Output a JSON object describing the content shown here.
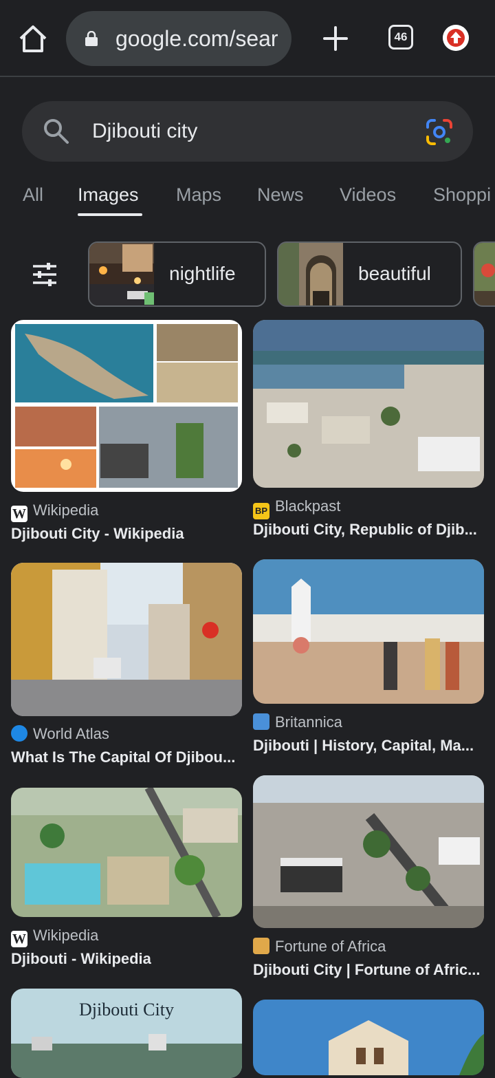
{
  "browser": {
    "url": "google.com/sear",
    "tab_count": "46"
  },
  "search": {
    "query": "Djibouti city"
  },
  "tabs": [
    {
      "label": "All"
    },
    {
      "label": "Images"
    },
    {
      "label": "Maps"
    },
    {
      "label": "News"
    },
    {
      "label": "Videos"
    },
    {
      "label": "Shoppi"
    }
  ],
  "chips": [
    {
      "label": "nightlife"
    },
    {
      "label": "beautiful"
    }
  ],
  "results": [
    {
      "source": "Wikipedia",
      "title": "Djibouti City - Wikipedia"
    },
    {
      "source": "Blackpast",
      "title": "Djibouti City, Republic of Djib..."
    },
    {
      "source": "World Atlas",
      "title": "What Is The Capital Of Djibou..."
    },
    {
      "source": "Britannica",
      "title": "Djibouti | History, Capital, Ma..."
    },
    {
      "source": "Wikipedia",
      "title": "Djibouti - Wikipedia"
    },
    {
      "source": "Fortune of Africa",
      "title": "Djibouti City | Fortune of Afric..."
    },
    {
      "caption": "Djibouti City"
    }
  ],
  "favicons": {
    "blackpast": "BP",
    "wikipedia": "W"
  }
}
